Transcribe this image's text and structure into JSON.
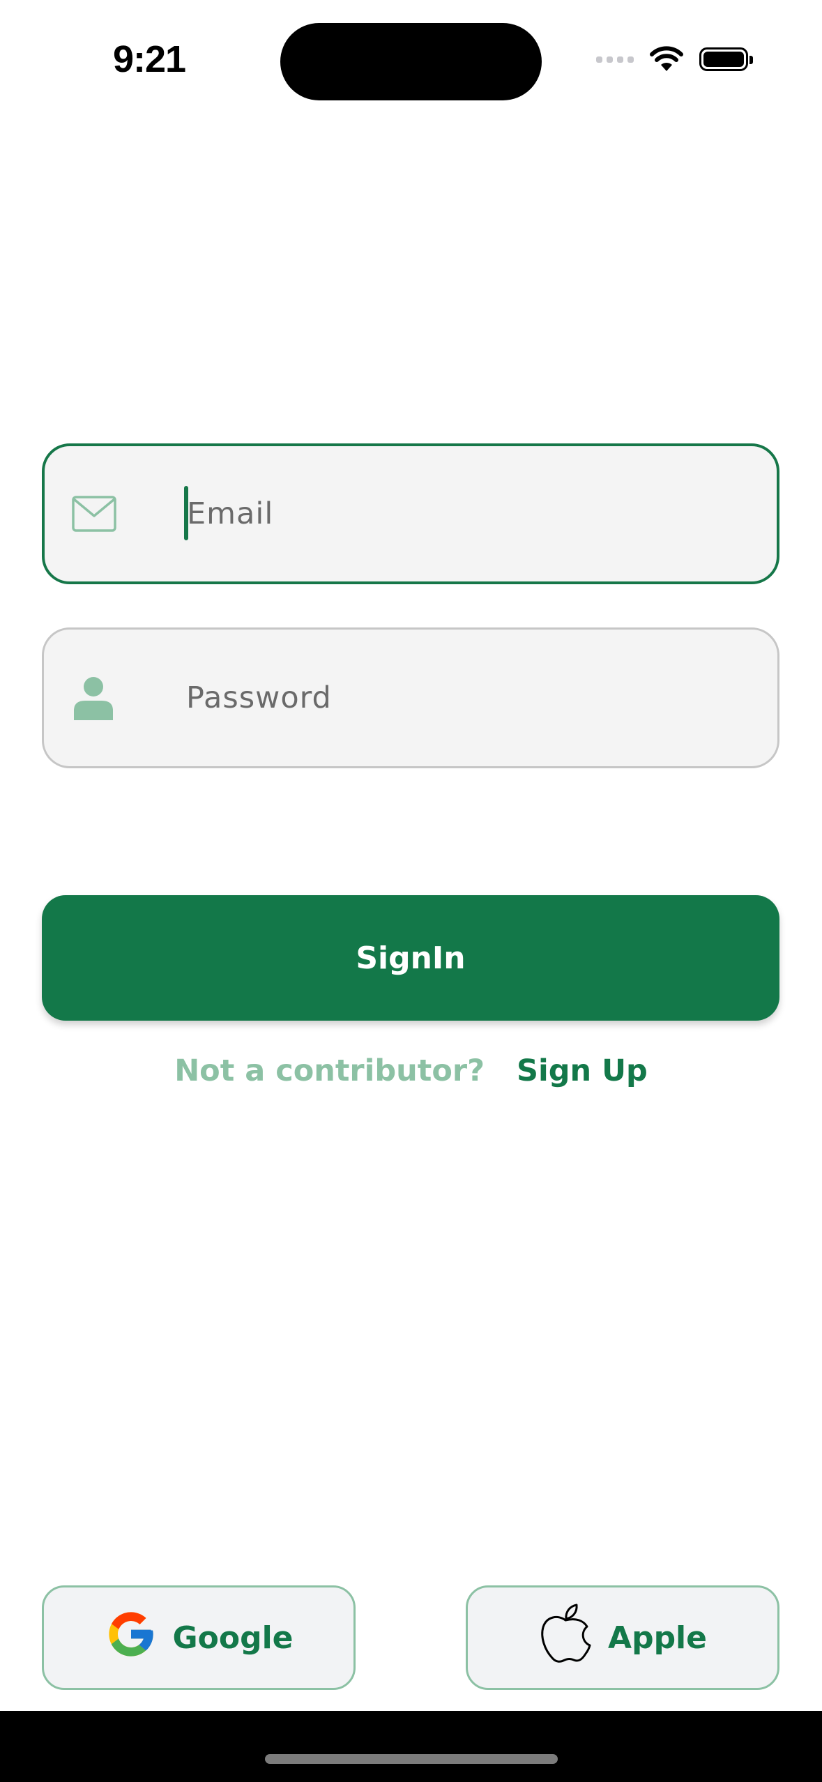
{
  "status_bar": {
    "time": "9:21"
  },
  "login_form": {
    "email": {
      "placeholder": "Email",
      "icon": "mail-icon",
      "focused": true
    },
    "password": {
      "placeholder": "Password",
      "icon": "person-icon"
    },
    "signin_label": "SignIn",
    "signup_prompt": "Not a contributor?",
    "signup_link": "Sign Up"
  },
  "social_login": {
    "google_label": "Google",
    "apple_label": "Apple"
  },
  "colors": {
    "primary": "#137849",
    "primary_light": "#8cc1a4",
    "field_background": "#f4f4f4",
    "placeholder": "#6a6a6a"
  }
}
